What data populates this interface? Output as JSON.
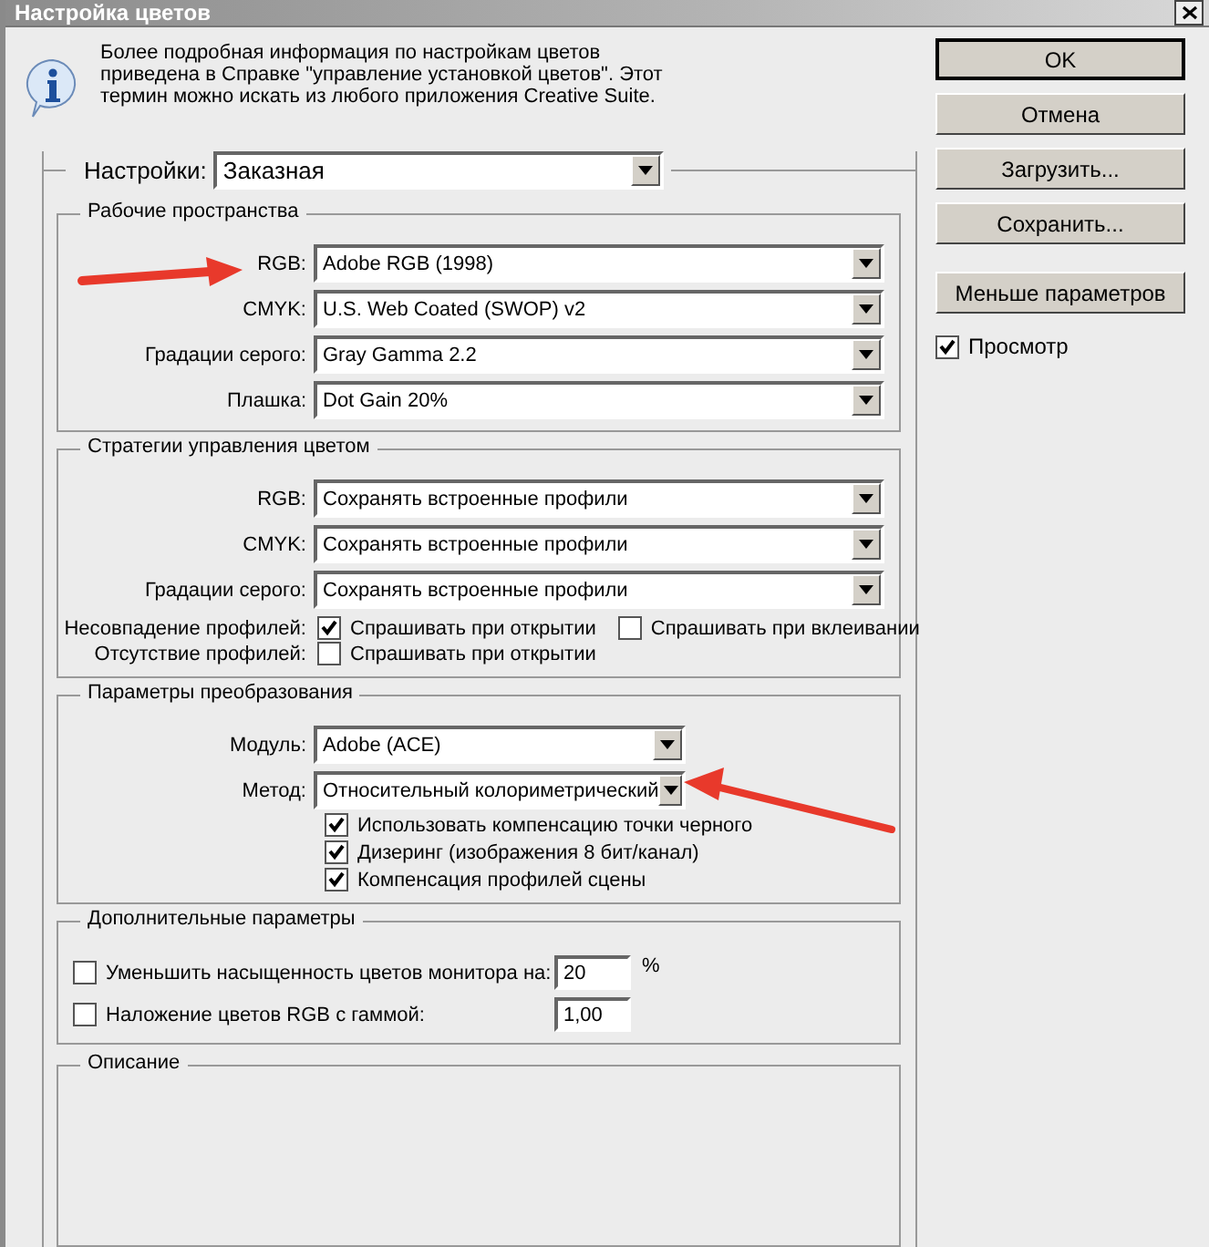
{
  "window": {
    "title": "Настройка цветов"
  },
  "info": "Более подробная информация по настройкам цветов приведена в Справке \"управление установкой цветов\". Этот термин можно искать из любого приложения Creative Suite.",
  "settings": {
    "label": "Настройки:",
    "value": "Заказная"
  },
  "working_spaces": {
    "title": "Рабочие пространства",
    "rows": [
      {
        "label": "RGB:",
        "value": "Adobe RGB (1998)"
      },
      {
        "label": "CMYK:",
        "value": "U.S. Web Coated (SWOP) v2"
      },
      {
        "label": "Градации серого:",
        "value": "Gray Gamma 2.2"
      },
      {
        "label": "Плашка:",
        "value": "Dot Gain 20%"
      }
    ]
  },
  "policies": {
    "title": "Стратегии управления цветом",
    "rows": [
      {
        "label": "RGB:",
        "value": "Сохранять встроенные профили"
      },
      {
        "label": "CMYK:",
        "value": "Сохранять встроенные профили"
      },
      {
        "label": "Градации серого:",
        "value": "Сохранять встроенные профили"
      }
    ],
    "checks": [
      {
        "label": "Несовпадение профилей:",
        "options": [
          {
            "label": "Спрашивать при открытии",
            "checked": true
          },
          {
            "label": "Спрашивать при вклеивании",
            "checked": false
          }
        ]
      },
      {
        "label": "Отсутствие профилей:",
        "options": [
          {
            "label": "Спрашивать при открытии",
            "checked": false
          }
        ]
      }
    ]
  },
  "conversion": {
    "title": "Параметры преобразования",
    "rows": [
      {
        "label": "Модуль:",
        "value": "Adobe (ACE)"
      },
      {
        "label": "Метод:",
        "value": "Относительный колориметрический"
      }
    ],
    "options": [
      {
        "label": "Использовать компенсацию точки черного",
        "checked": true
      },
      {
        "label": "Дизеринг (изображения 8 бит/канал)",
        "checked": true
      },
      {
        "label": "Компенсация профилей сцены",
        "checked": true
      }
    ]
  },
  "advanced": {
    "title": "Дополнительные параметры",
    "options": [
      {
        "label": "Уменьшить насыщенность цветов монитора на:",
        "checked": false,
        "value": "20",
        "unit": "%"
      },
      {
        "label": "Наложение цветов RGB с гаммой:",
        "checked": false,
        "value": "1,00"
      }
    ]
  },
  "description": {
    "title": "Описание"
  },
  "buttons": [
    {
      "label": "OK",
      "default": true
    },
    {
      "label": "Отмена",
      "default": false
    },
    {
      "label": "Загрузить...",
      "default": false
    },
    {
      "label": "Сохранить...",
      "default": false
    },
    {
      "label": "Меньше параметров",
      "default": false
    }
  ],
  "preview": {
    "label": "Просмотр",
    "checked": true
  }
}
